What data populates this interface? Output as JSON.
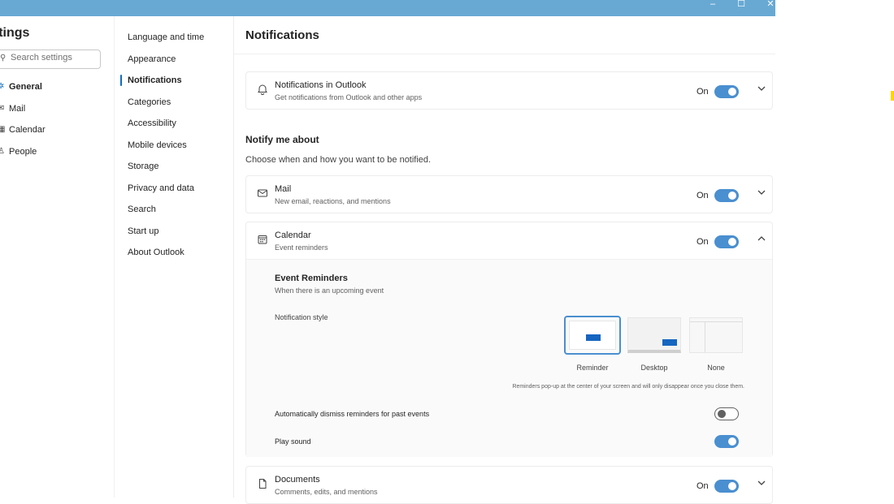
{
  "window": {
    "minimize_glyph": "–",
    "maximize_glyph": "☐",
    "close_glyph": "✕"
  },
  "sidebar": {
    "title": "ettings",
    "search_placeholder": "Search settings",
    "items": [
      {
        "label": "General",
        "icon": "gear-icon",
        "glyph": "✲",
        "active": true
      },
      {
        "label": "Mail",
        "icon": "mail-icon",
        "glyph": "✉",
        "active": false
      },
      {
        "label": "Calendar",
        "icon": "calendar-icon",
        "glyph": "▦",
        "active": false
      },
      {
        "label": "People",
        "icon": "people-icon",
        "glyph": "♙",
        "active": false
      }
    ]
  },
  "subnav": {
    "items": [
      {
        "label": "Language and time",
        "active": false
      },
      {
        "label": "Appearance",
        "active": false
      },
      {
        "label": "Notifications",
        "active": true
      },
      {
        "label": "Categories",
        "active": false
      },
      {
        "label": "Accessibility",
        "active": false
      },
      {
        "label": "Mobile devices",
        "active": false
      },
      {
        "label": "Storage",
        "active": false
      },
      {
        "label": "Privacy and data",
        "active": false
      },
      {
        "label": "Search",
        "active": false
      },
      {
        "label": "Start up",
        "active": false
      },
      {
        "label": "About Outlook",
        "active": false
      }
    ]
  },
  "main": {
    "title": "Notifications",
    "outlook": {
      "title": "Notifications in Outlook",
      "subtitle": "Get notifications from Outlook and other apps",
      "state": "On"
    },
    "notify_title": "Notify me about",
    "notify_subtitle": "Choose when and how you want to be notified.",
    "mail": {
      "title": "Mail",
      "subtitle": "New email, reactions, and mentions",
      "state": "On"
    },
    "calendar": {
      "title": "Calendar",
      "subtitle": "Event reminders",
      "state": "On",
      "event_reminders_title": "Event Reminders",
      "event_reminders_subtitle": "When there is an upcoming event",
      "notification_style_label": "Notification style",
      "styles": [
        "Reminder",
        "Desktop",
        "None"
      ],
      "selected_style": "Reminder",
      "note": "Reminders pop-up at the center of your screen and will only disappear once you close them.",
      "auto_dismiss_label": "Automatically dismiss reminders for past events",
      "auto_dismiss_on": false,
      "play_sound_label": "Play sound",
      "play_sound_on": true
    },
    "documents": {
      "title": "Documents",
      "subtitle": "Comments, edits, and mentions",
      "state": "On"
    }
  },
  "colors": {
    "titlebar": "#68a9d3",
    "accent": "#4a8fd0",
    "preview_blue": "#1565c0"
  }
}
